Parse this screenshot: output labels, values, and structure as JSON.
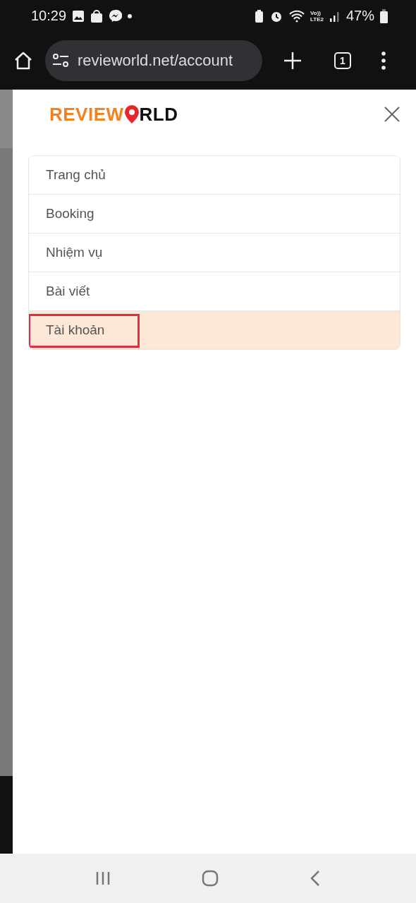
{
  "status_bar": {
    "time": "10:29",
    "volte": "Vo))",
    "lte": "LTE2",
    "battery": "47%"
  },
  "browser": {
    "url": "revieworld.net/account",
    "tab_count": "1"
  },
  "logo": {
    "left": "REVIEW",
    "right": "RLD"
  },
  "menu": [
    {
      "label": "Trang chủ",
      "selected": false,
      "annotated": false
    },
    {
      "label": "Booking",
      "selected": false,
      "annotated": false
    },
    {
      "label": "Nhiệm vụ",
      "selected": false,
      "annotated": false
    },
    {
      "label": "Bài viết",
      "selected": false,
      "annotated": false
    },
    {
      "label": "Tài khoản",
      "selected": true,
      "annotated": true
    }
  ]
}
